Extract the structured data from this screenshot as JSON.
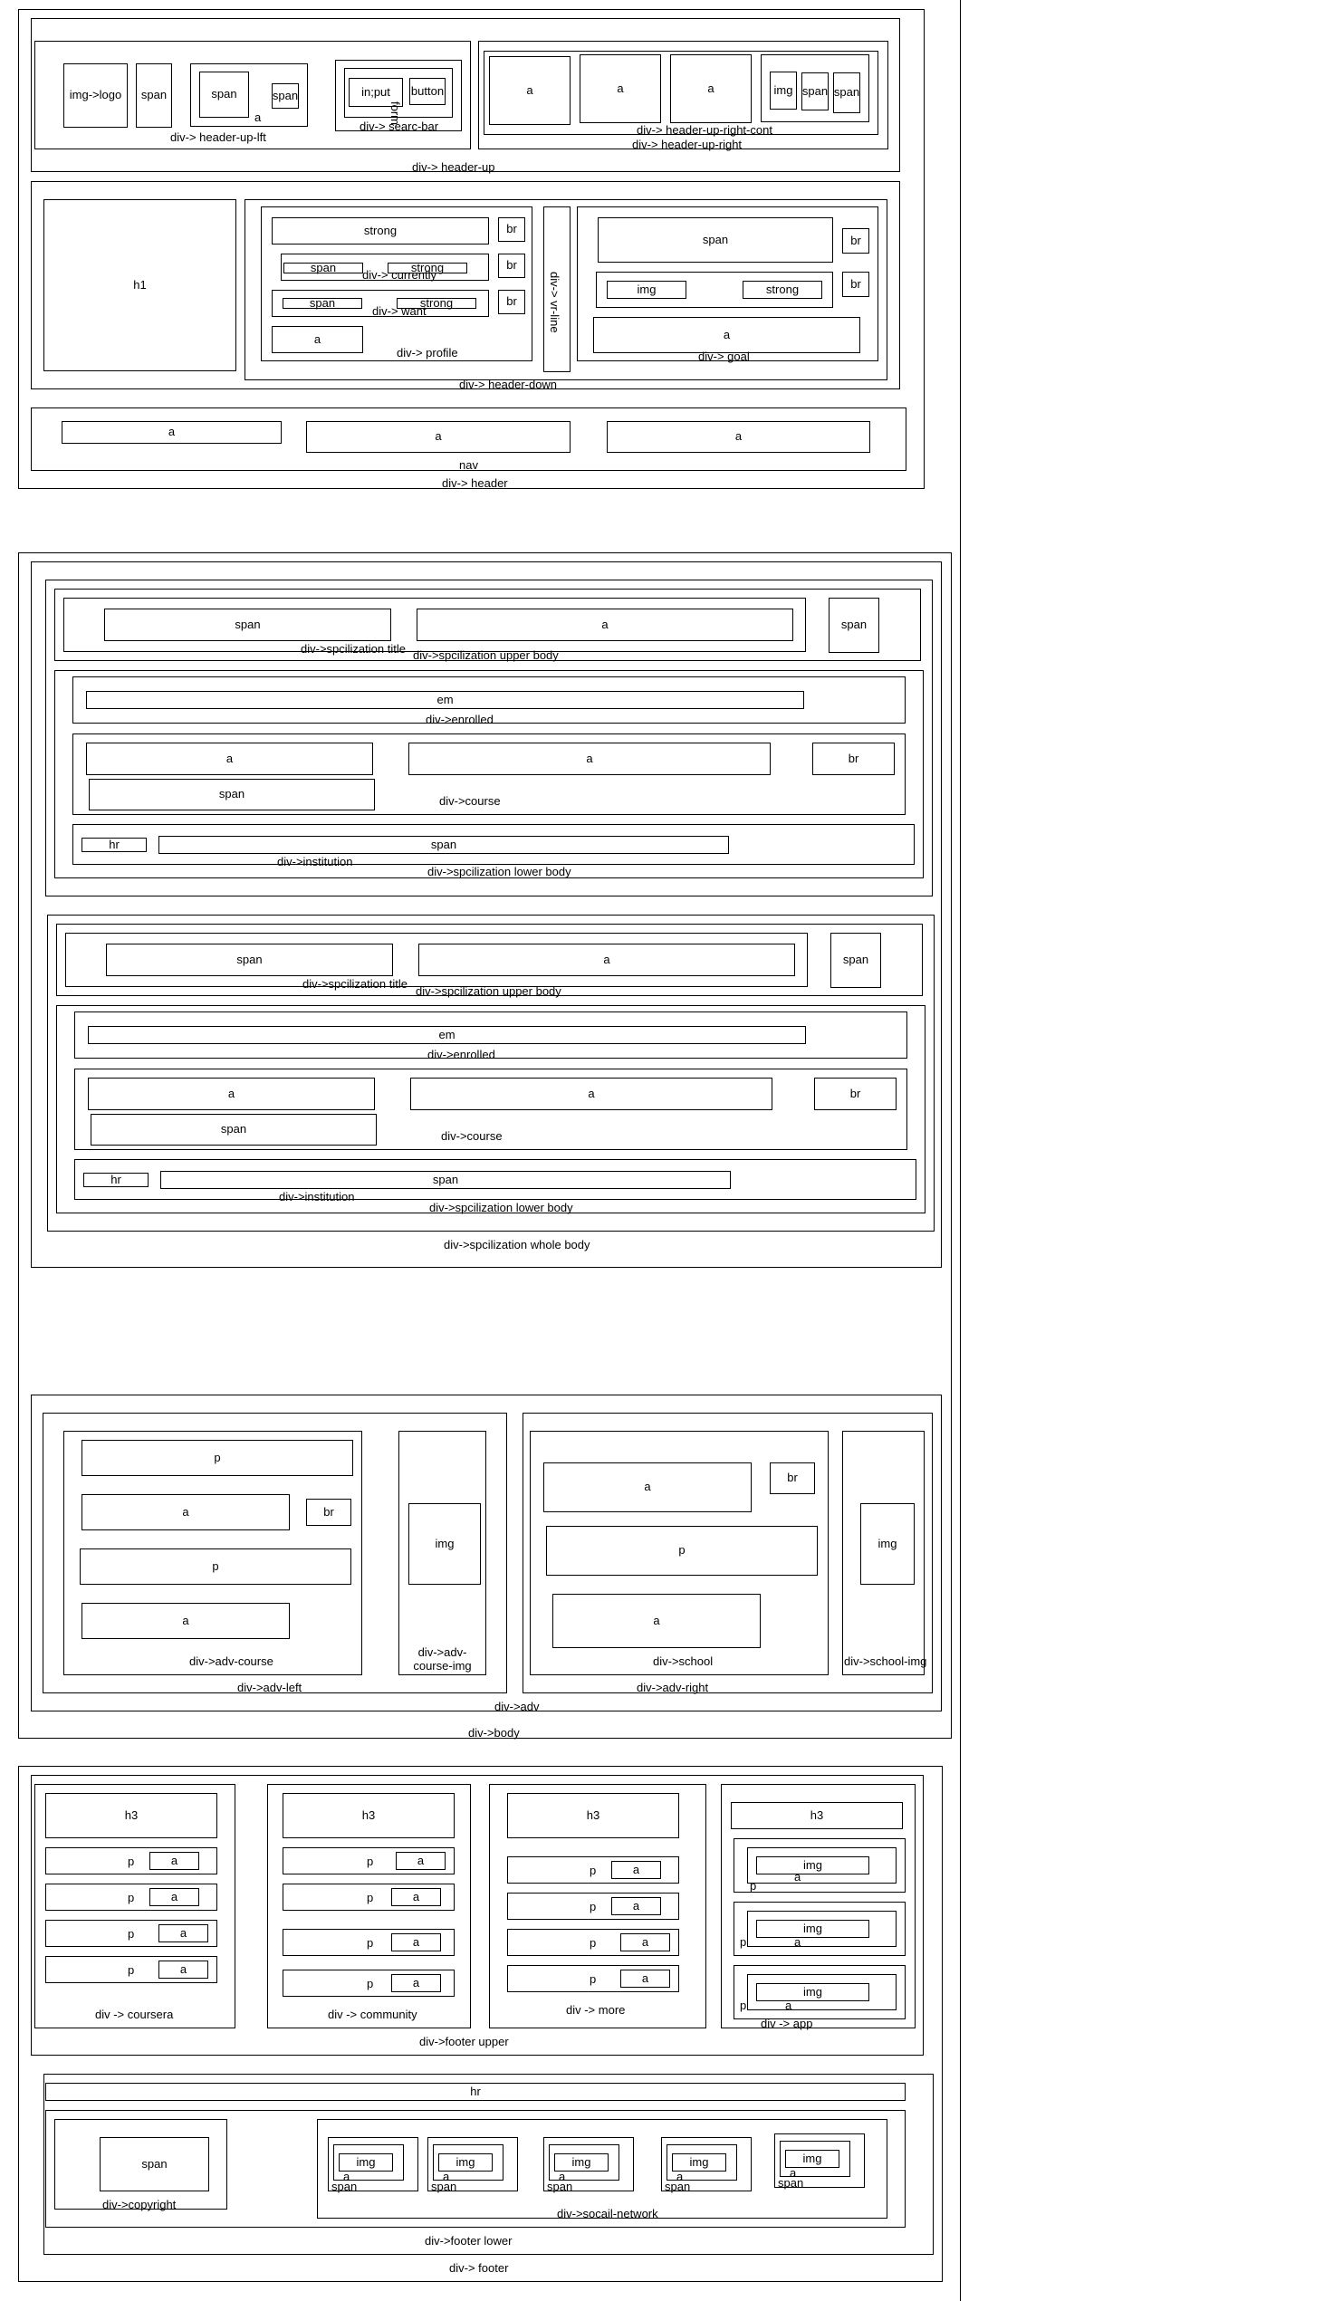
{
  "h": {
    "logo": "img->logo",
    "span": "span",
    "a": "a",
    "input": "in;put",
    "button": "button",
    "form": "form",
    "search": "div-> searc-bar",
    "img": "img",
    "cont": "div-> header-up-right-cont",
    "right": "div-> header-up-right",
    "left": "div-> header-up-lft",
    "up": "div-> header-up",
    "h1": "h1",
    "strong": "strong",
    "br": "br",
    "currently": "div-> currently",
    "want": "div-> want",
    "profile": "div-> profile",
    "vline": "div-> vr-line",
    "goal": "div-> goal",
    "down": "div-> header-down",
    "nav": "nav",
    "header": "div-> header"
  },
  "s": {
    "span": "span",
    "a": "a",
    "em": "em",
    "br": "br",
    "hr": "hr",
    "title": "div->spcilization title",
    "upper": "div->spcilization upper body",
    "enrolled": "div->enrolled",
    "course": "div->course",
    "institution": "div->institution",
    "lower": "div->spcilization lower body",
    "whole": "div->spcilization whole body"
  },
  "adv": {
    "p": "p",
    "a": "a",
    "br": "br",
    "img": "img",
    "course": "div->adv-course",
    "course_img": "div->adv-course-img",
    "left": "div->adv-left",
    "school": "div->school",
    "school_img": "div->school-img",
    "right": "div->adv-right",
    "adv": "div->adv",
    "body": "div->body"
  },
  "f": {
    "h3": "h3",
    "p": "p",
    "a": "a",
    "img": "img",
    "span": "span",
    "hr": "hr",
    "coursera": "div -> coursera",
    "community": "div -> community",
    "more": "div -> more",
    "app": "div -> app",
    "upper": "div->footer upper",
    "copyright": "div->copyright",
    "social": "div->socail-network",
    "lower": "div->footer lower",
    "footer": "div-> footer"
  }
}
